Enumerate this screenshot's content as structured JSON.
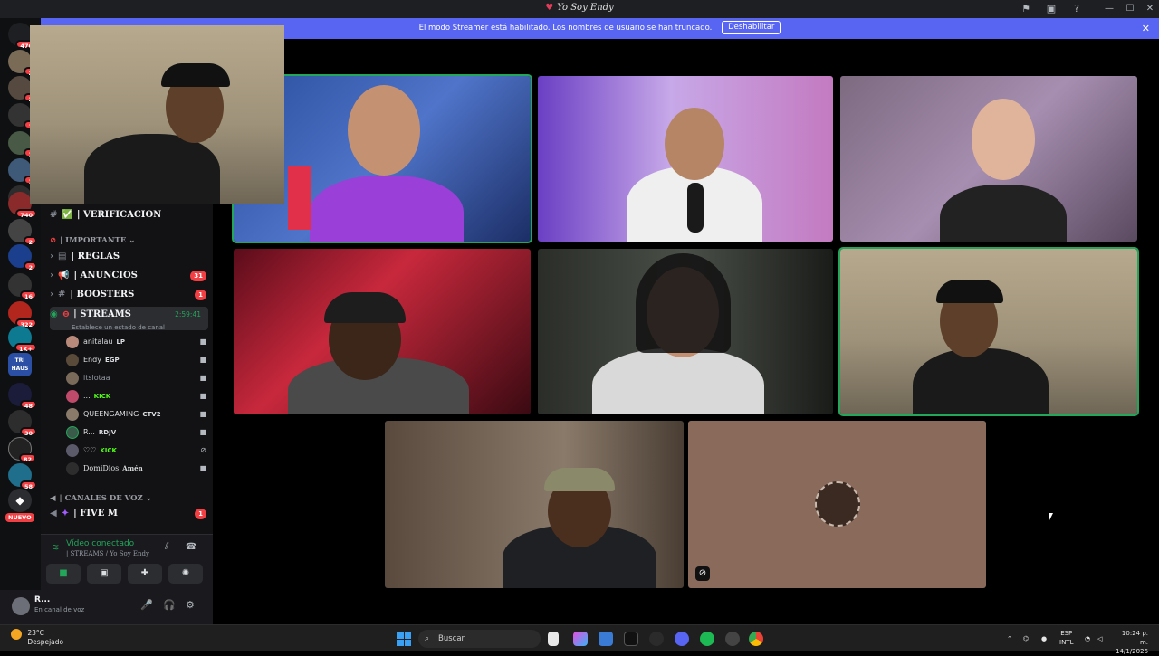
{
  "window": {
    "title": "Yo Soy Endy"
  },
  "banner": {
    "text": "El modo Streamer está habilitado. Los nombres de usuario se han truncado.",
    "disable_label": "Deshabilitar"
  },
  "rail": {
    "badges": [
      "476",
      "2",
      "2",
      "1",
      "1",
      "1",
      "740",
      "2",
      "2",
      "16",
      "322",
      "1K+",
      "48",
      "30",
      "82",
      "58"
    ],
    "tri_haus": "TRI HAUS",
    "new_label": "NUEVO"
  },
  "sidebar": {
    "verificacion": "| VERIFICACION",
    "cat_importante": "| IMPORTANTE",
    "reglas": "| REGLAS",
    "anuncios": "| ANUNCIOS",
    "anuncios_count": "31",
    "boosters": "| BOOSTERS",
    "boosters_count": "1",
    "streams": "| STREAMS",
    "streams_timer": "2:59:41",
    "streams_status": "Establece un estado de canal",
    "members": [
      {
        "name": "anitalau",
        "tag": "LP",
        "tag_color": "#ffffff"
      },
      {
        "name": "Endy",
        "tag": "EGP",
        "tag_color": "#ffffff"
      },
      {
        "name": "itslotaa",
        "tag": "",
        "tag_color": "#ffffff"
      },
      {
        "name": "...",
        "tag": "KICK",
        "tag_color": "#53fc18"
      },
      {
        "name": "QUEENGAMING",
        "tag": "CTV2",
        "tag_color": "#ffffff"
      },
      {
        "name": "R...",
        "tag": "RDJV",
        "tag_color": "#ffffff"
      },
      {
        "name": "♡♡",
        "tag": "KICK",
        "tag_color": "#53fc18"
      },
      {
        "name": "DomiDios",
        "tag": "Amén",
        "tag_color": "#ffffff"
      }
    ],
    "cat_voz": "| CANALES DE VOZ",
    "five_m": "| FIVE M",
    "five_m_count": "1"
  },
  "voice": {
    "status": "Vídeo conectado",
    "channel": "| STREAMS / Yo Soy Endy"
  },
  "user": {
    "name": "R...",
    "status": "En canal de voz"
  },
  "taskbar": {
    "temp": "23°C",
    "weather": "Despejado",
    "search_placeholder": "Buscar",
    "lang": "ESP",
    "layout": "INTL",
    "time": "10:24 p. m.",
    "date": "14/1/2026"
  },
  "colors": {
    "accent": "#5865f2",
    "speaking": "#23a55a",
    "badge": "#f23f43"
  }
}
